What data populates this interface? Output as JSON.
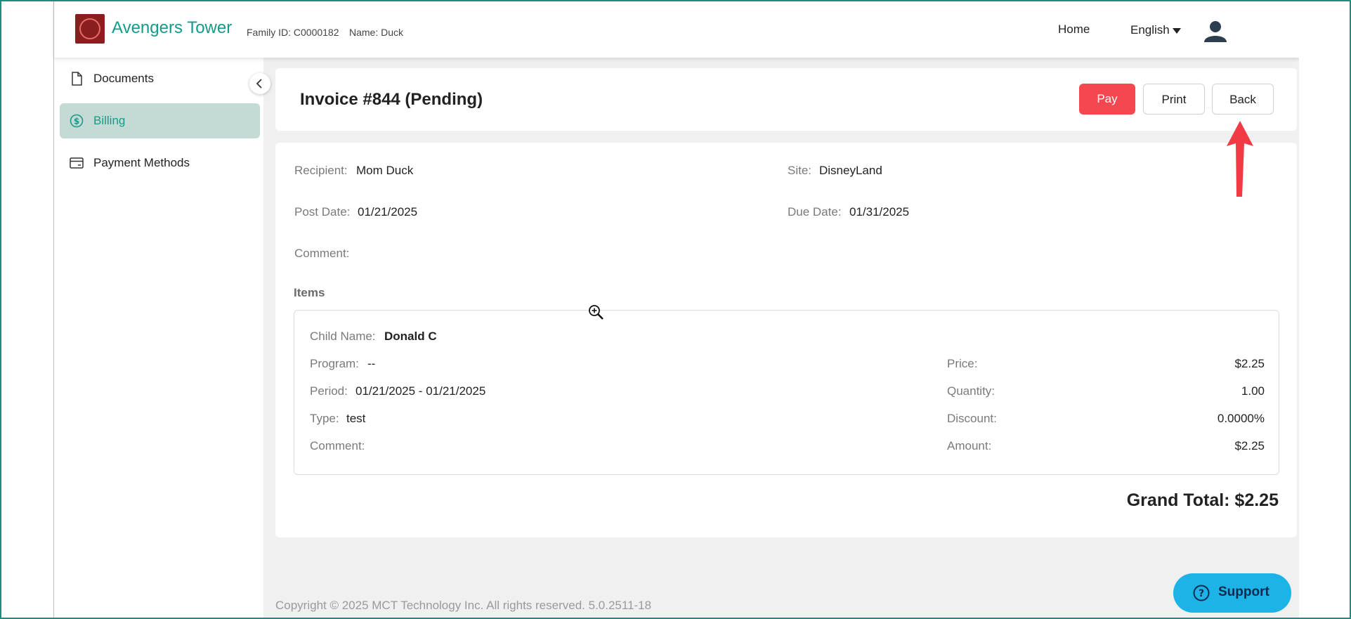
{
  "header": {
    "brand": "Avengers Tower",
    "family_id": "Family ID: C0000182",
    "name": "Name: Duck",
    "nav_home": "Home",
    "nav_language": "English"
  },
  "sidebar": {
    "items": [
      {
        "label": "Documents",
        "icon": "document-icon",
        "active": false
      },
      {
        "label": "Billing",
        "icon": "dollar-circle-icon",
        "active": true
      },
      {
        "label": "Payment Methods",
        "icon": "credit-card-icon",
        "active": false
      }
    ]
  },
  "invoice": {
    "title": "Invoice #844 (Pending)",
    "buttons": {
      "pay": "Pay",
      "print": "Print",
      "back": "Back"
    },
    "recipient_label": "Recipient:",
    "recipient": "Mom Duck",
    "site_label": "Site:",
    "site": "DisneyLand",
    "post_date_label": "Post Date:",
    "post_date": "01/21/2025",
    "due_date_label": "Due Date:",
    "due_date": "01/31/2025",
    "comment_label": "Comment:",
    "items_heading": "Items",
    "item": {
      "child_name_label": "Child Name:",
      "child_name": "Donald C",
      "program_label": "Program:",
      "program": "--",
      "period_label": "Period:",
      "period": "01/21/2025 - 01/21/2025",
      "type_label": "Type:",
      "type": "test",
      "comment_label": "Comment:",
      "price_label": "Price:",
      "price": "$2.25",
      "quantity_label": "Quantity:",
      "quantity": "1.00",
      "discount_label": "Discount:",
      "discount": "0.0000%",
      "amount_label": "Amount:",
      "amount": "$2.25"
    },
    "grand_total": "Grand Total: $2.25"
  },
  "footer": {
    "copyright": "Copyright © 2025 MCT Technology Inc. All rights reserved. 5.0.2511-18"
  },
  "support": {
    "label": "Support"
  },
  "colors": {
    "accent": "#169b89",
    "pay_button": "#f5474f",
    "support_button": "#1db3e6",
    "active_bg": "#c3dbd4",
    "frame": "#16917f"
  }
}
